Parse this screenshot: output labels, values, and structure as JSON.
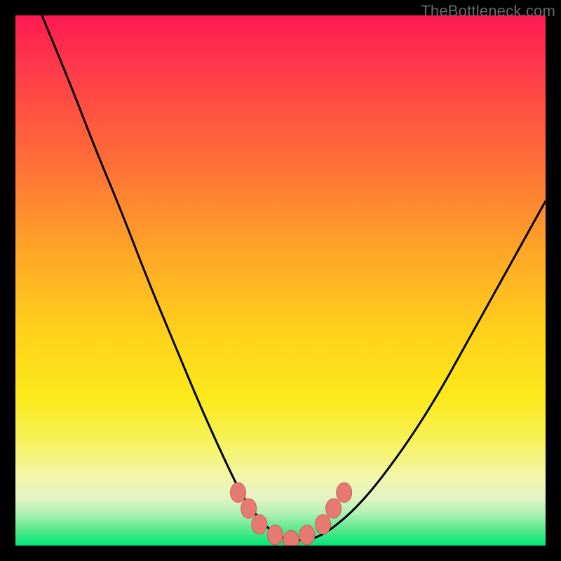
{
  "watermark": {
    "text": "TheBottleneck.com"
  },
  "colors": {
    "background": "#000000",
    "curve_stroke": "#000000",
    "marker_fill": "#e67a72",
    "marker_stroke": "#cc5a52",
    "watermark": "#696969"
  },
  "chart_data": {
    "type": "line",
    "title": "",
    "xlabel": "",
    "ylabel": "",
    "xlim": [
      0,
      100
    ],
    "ylim": [
      0,
      100
    ],
    "grid": false,
    "note": "V-shaped bottleneck curve over a red-to-green vertical gradient. y axis inverted visually (0 at bottom = green/good, 100 at top = red/bad). Values estimated from pixels; no axis ticks present in image.",
    "series": [
      {
        "name": "bottleneck-curve",
        "x": [
          5,
          10,
          15,
          20,
          25,
          30,
          35,
          40,
          43,
          46,
          49,
          52,
          55,
          58,
          62,
          66,
          70,
          75,
          80,
          85,
          90,
          95,
          100
        ],
        "y": [
          100,
          88,
          75,
          63,
          50,
          38,
          26,
          15,
          9,
          5,
          2,
          1,
          1,
          2,
          5,
          9,
          14,
          21,
          29,
          38,
          47,
          56,
          65
        ]
      }
    ],
    "markers": {
      "name": "highlight-points",
      "x": [
        42,
        44,
        46,
        49,
        52,
        55,
        58,
        60,
        62
      ],
      "y": [
        10,
        7,
        4,
        2,
        1,
        2,
        4,
        7,
        10
      ]
    }
  }
}
